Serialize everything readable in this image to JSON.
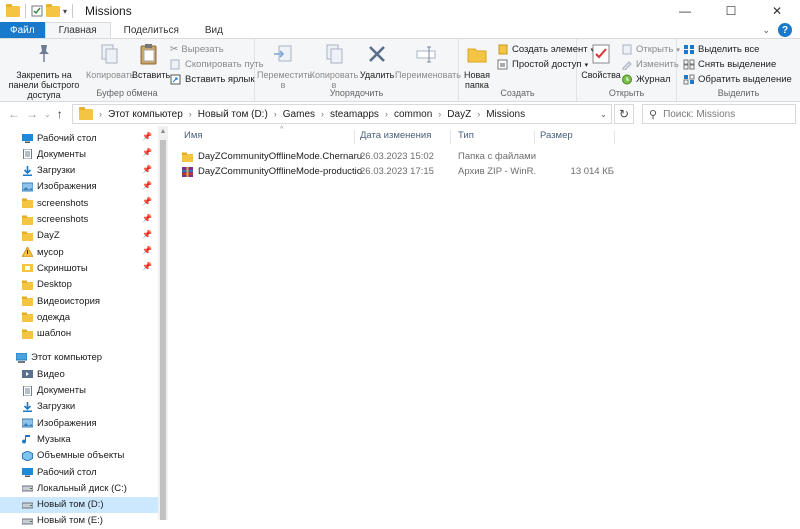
{
  "window": {
    "title": "Missions",
    "minimize": "—",
    "maximize": "☐",
    "close": "✕"
  },
  "tabs": {
    "file": "Файл",
    "home": "Главная",
    "share": "Поделиться",
    "view": "Вид"
  },
  "ribbon": {
    "clipboard": {
      "pin_label": "Закрепить на панели быстрого доступа",
      "copy_label": "Копировать",
      "paste_label": "Вставить",
      "cut_label": "Вырезать",
      "copy_path_label": "Скопировать путь",
      "paste_shortcut_label": "Вставить ярлык",
      "group_label": "Буфер обмена"
    },
    "organize": {
      "move_label": "Переместить в",
      "copy_to_label": "Копировать в",
      "delete_label": "Удалить",
      "rename_label": "Переименовать",
      "group_label": "Упорядочить"
    },
    "create": {
      "new_folder_label": "Новая папка",
      "new_item_label": "Создать элемент",
      "easy_access_label": "Простой доступ",
      "group_label": "Создать"
    },
    "open": {
      "properties_label": "Свойства",
      "open_label": "Открыть",
      "edit_label": "Изменить",
      "history_label": "Журнал",
      "group_label": "Открыть"
    },
    "select": {
      "select_all_label": "Выделить все",
      "select_none_label": "Снять выделение",
      "invert_label": "Обратить выделение",
      "group_label": "Выделить"
    }
  },
  "address": {
    "crumbs": [
      "Этот компьютер",
      "Новый том (D:)",
      "Games",
      "steamapps",
      "common",
      "DayZ",
      "Missions"
    ],
    "search_placeholder": "Поиск: Missions"
  },
  "navpane": {
    "quick_access": [
      {
        "label": "Рабочий стол",
        "icon": "desktop-icon"
      },
      {
        "label": "Документы",
        "icon": "documents-icon"
      },
      {
        "label": "Загрузки",
        "icon": "downloads-icon"
      },
      {
        "label": "Изображения",
        "icon": "pictures-icon"
      },
      {
        "label": "screenshots",
        "icon": "folder-icon"
      },
      {
        "label": "screenshots",
        "icon": "folder-icon"
      },
      {
        "label": "DayZ",
        "icon": "folder-icon"
      },
      {
        "label": "мусор",
        "icon": "warning-icon"
      },
      {
        "label": "Скриншоты",
        "icon": "screenshots-icon"
      },
      {
        "label": "Desktop",
        "icon": "folder-icon"
      },
      {
        "label": "Видеоистория",
        "icon": "folder-icon"
      },
      {
        "label": "одежда",
        "icon": "folder-icon"
      },
      {
        "label": "шаблон",
        "icon": "folder-icon"
      }
    ],
    "this_pc": "Этот компьютер",
    "pc_items": [
      {
        "label": "Видео",
        "icon": "videos-icon"
      },
      {
        "label": "Документы",
        "icon": "documents-icon"
      },
      {
        "label": "Загрузки",
        "icon": "downloads-icon"
      },
      {
        "label": "Изображения",
        "icon": "pictures-icon"
      },
      {
        "label": "Музыка",
        "icon": "music-icon"
      },
      {
        "label": "Объемные объекты",
        "icon": "3d-objects-icon"
      },
      {
        "label": "Рабочий стол",
        "icon": "desktop-icon"
      },
      {
        "label": "Локальный диск (C:)",
        "icon": "drive-icon"
      },
      {
        "label": "Новый том (D:)",
        "icon": "drive-icon"
      },
      {
        "label": "Новый том (E:)",
        "icon": "drive-icon"
      }
    ]
  },
  "columns": {
    "name": "Имя",
    "date": "Дата изменения",
    "type": "Тип",
    "size": "Размер"
  },
  "files": [
    {
      "name": "DayZCommunityOfflineMode.Chernarus...",
      "date": "26.03.2023 15:02",
      "type": "Папка с файлами",
      "size": "",
      "icon": "folder-icon"
    },
    {
      "name": "DayZCommunityOfflineMode-production",
      "date": "26.03.2023 17:15",
      "type": "Архив ZIP - WinR...",
      "size": "13 014 КБ",
      "icon": "winrar-archive-icon"
    }
  ],
  "colors": {
    "accent": "#1979ca",
    "selection": "#cce8ff",
    "folder": "#f4c542"
  }
}
